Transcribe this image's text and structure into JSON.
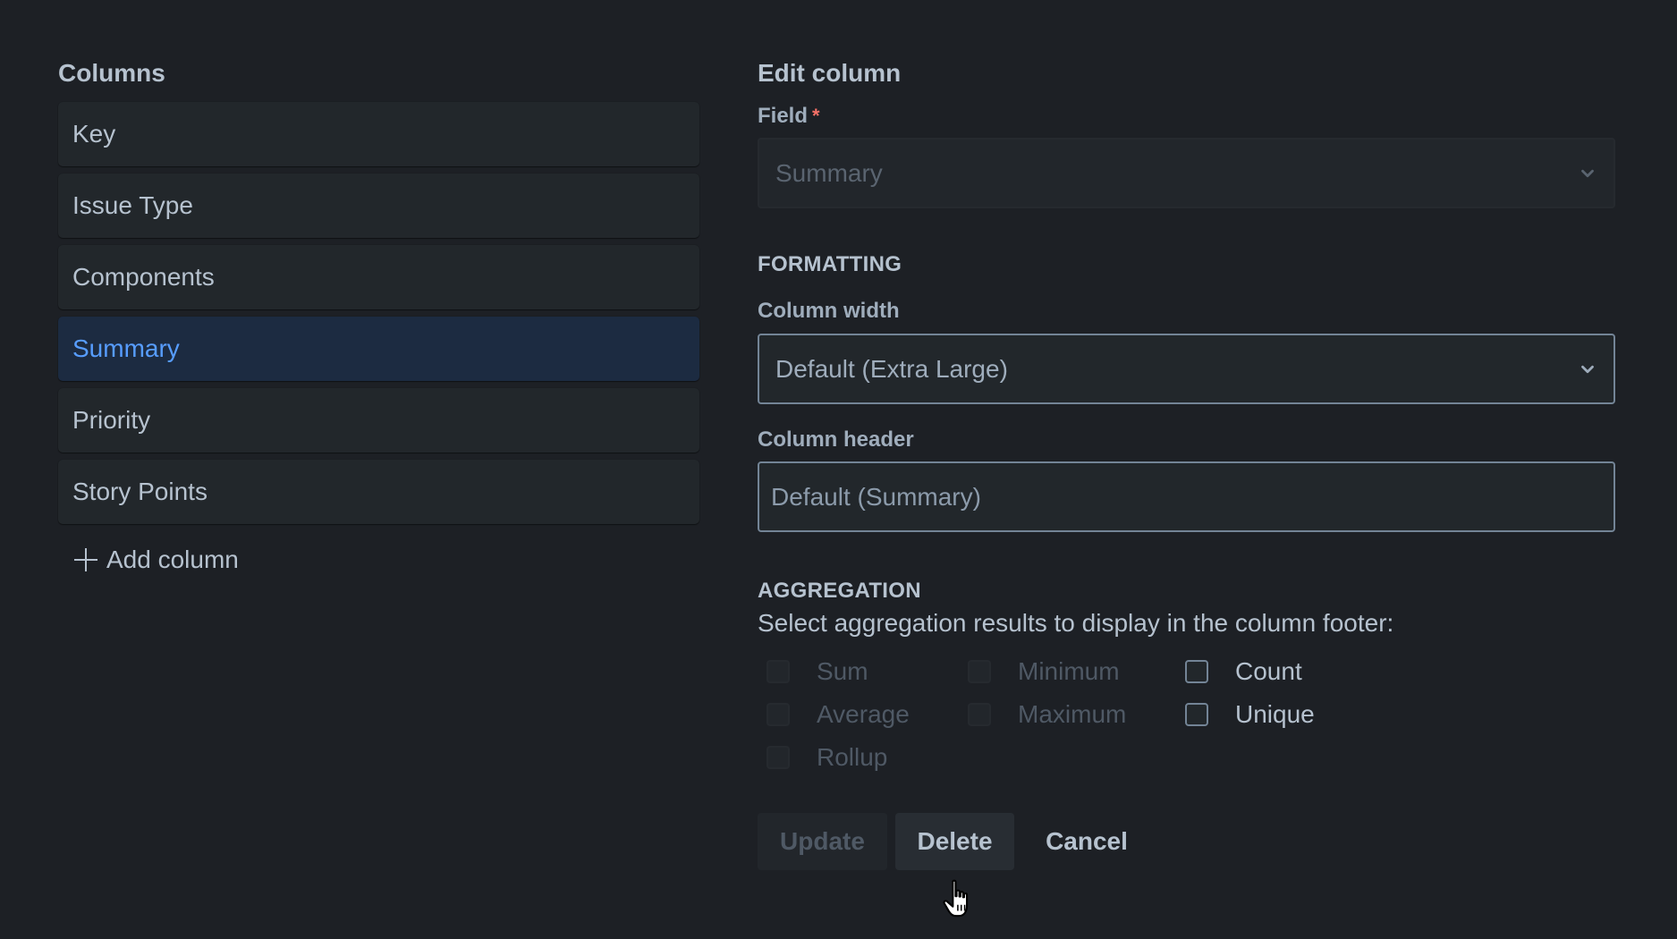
{
  "columns_panel": {
    "title": "Columns",
    "items": [
      {
        "label": "Key",
        "selected": false
      },
      {
        "label": "Issue Type",
        "selected": false
      },
      {
        "label": "Components",
        "selected": false
      },
      {
        "label": "Summary",
        "selected": true
      },
      {
        "label": "Priority",
        "selected": false
      },
      {
        "label": "Story Points",
        "selected": false
      }
    ],
    "add_column_label": "Add column",
    "add_icon": "plus-icon"
  },
  "edit_panel": {
    "title": "Edit column",
    "field": {
      "label": "Field",
      "required_marker": "*",
      "value": "Summary",
      "disabled": true,
      "icon": "chevron-down-icon"
    },
    "formatting": {
      "heading": "FORMATTING",
      "column_width": {
        "label": "Column width",
        "value": "Default (Extra Large)",
        "icon": "chevron-down-icon"
      },
      "column_header": {
        "label": "Column header",
        "placeholder": "Default (Summary)",
        "value": ""
      }
    },
    "aggregation": {
      "heading": "AGGREGATION",
      "description": "Select aggregation results to display in the column footer:",
      "options": [
        {
          "label": "Sum",
          "checked": false,
          "disabled": true
        },
        {
          "label": "Average",
          "checked": false,
          "disabled": true
        },
        {
          "label": "Rollup",
          "checked": false,
          "disabled": true
        },
        {
          "label": "Minimum",
          "checked": false,
          "disabled": true
        },
        {
          "label": "Maximum",
          "checked": false,
          "disabled": true
        },
        {
          "label": "Count",
          "checked": false,
          "disabled": false
        },
        {
          "label": "Unique",
          "checked": false,
          "disabled": false
        }
      ]
    },
    "buttons": {
      "update": "Update",
      "delete": "Delete",
      "cancel": "Cancel"
    }
  },
  "colors": {
    "background": "#1d2025",
    "item_bg": "#22272b",
    "selected_bg": "#1c2b41",
    "selected_text": "#579dff",
    "text": "#b6c2cf",
    "required": "#f87168",
    "border": "#738496"
  }
}
